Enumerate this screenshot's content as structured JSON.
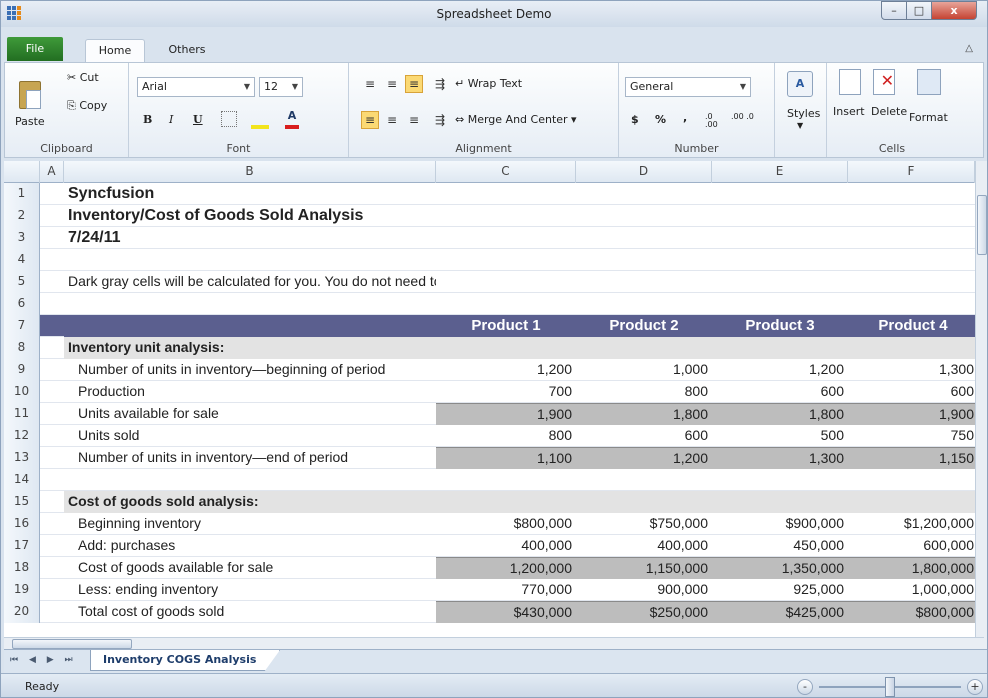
{
  "window": {
    "title": "Spreadsheet Demo",
    "min_label": "–",
    "max_label": "□",
    "close_label": "x"
  },
  "tabs": {
    "file": "File",
    "home": "Home",
    "others": "Others",
    "collapse": "△"
  },
  "ribbon": {
    "clipboard": {
      "paste": "Paste",
      "cut": "Cut",
      "copy": "Copy",
      "label": "Clipboard"
    },
    "font": {
      "name": "Arial",
      "size": "12",
      "bold": "B",
      "italic": "I",
      "underline": "U",
      "label": "Font"
    },
    "alignment": {
      "wrap_text": "Wrap Text",
      "merge_center": "Merge And Center",
      "label": "Alignment"
    },
    "number": {
      "format": "General",
      "currency": "$",
      "percent": "%",
      "comma": ",",
      "inc_decimal": ".0 .00",
      "dec_decimal": ".00 .0",
      "label": "Number"
    },
    "styles": {
      "label": "Styles"
    },
    "cells": {
      "insert": "Insert",
      "delete": "Delete",
      "format": "Format",
      "label": "Cells"
    }
  },
  "columns": [
    "A",
    "B",
    "C",
    "D",
    "E",
    "F"
  ],
  "rows": [
    {
      "n": "1",
      "b": "Syncfusion",
      "style": "title"
    },
    {
      "n": "2",
      "b": "Inventory/Cost of Goods Sold Analysis",
      "style": "title"
    },
    {
      "n": "3",
      "b": "7/24/11",
      "style": "title"
    },
    {
      "n": "4",
      "b": "",
      "style": "plain"
    },
    {
      "n": "5",
      "b": "Dark gray cells will be calculated for you. You do not need to enter anything into them.",
      "style": "plain"
    },
    {
      "n": "6",
      "b": "",
      "style": "plain"
    },
    {
      "n": "7",
      "b": "",
      "c": "Product 1",
      "d": "Product 2",
      "e": "Product 3",
      "f": "Product 4",
      "style": "header"
    },
    {
      "n": "8",
      "b": "Inventory unit analysis:",
      "style": "section"
    },
    {
      "n": "9",
      "b": "Number of units in inventory—beginning of period",
      "c": "1,200",
      "d": "1,000",
      "e": "1,200",
      "f": "1,300",
      "style": "data"
    },
    {
      "n": "10",
      "b": "Production",
      "c": "700",
      "d": "800",
      "e": "600",
      "f": "600",
      "style": "data"
    },
    {
      "n": "11",
      "b": "Units available for sale",
      "c": "1,900",
      "d": "1,800",
      "e": "1,800",
      "f": "1,900",
      "style": "calc"
    },
    {
      "n": "12",
      "b": "Units sold",
      "c": "800",
      "d": "600",
      "e": "500",
      "f": "750",
      "style": "data"
    },
    {
      "n": "13",
      "b": "Number of units in inventory—end of period",
      "c": "1,100",
      "d": "1,200",
      "e": "1,300",
      "f": "1,150",
      "style": "calc"
    },
    {
      "n": "14",
      "b": "",
      "style": "plain"
    },
    {
      "n": "15",
      "b": "Cost of goods sold analysis:",
      "style": "section"
    },
    {
      "n": "16",
      "b": "Beginning inventory",
      "c": "$800,000",
      "d": "$750,000",
      "e": "$900,000",
      "f": "$1,200,000",
      "style": "data"
    },
    {
      "n": "17",
      "b": "Add: purchases",
      "c": "400,000",
      "d": "400,000",
      "e": "450,000",
      "f": "600,000",
      "style": "data"
    },
    {
      "n": "18",
      "b": "Cost of goods available for sale",
      "c": "1,200,000",
      "d": "1,150,000",
      "e": "1,350,000",
      "f": "1,800,000",
      "style": "calc"
    },
    {
      "n": "19",
      "b": "Less: ending inventory",
      "c": "770,000",
      "d": "900,000",
      "e": "925,000",
      "f": "1,000,000",
      "style": "data"
    },
    {
      "n": "20",
      "b": "Total cost of goods sold",
      "c": "$430,000",
      "d": "$250,000",
      "e": "$425,000",
      "f": "$800,000",
      "style": "calc"
    }
  ],
  "sheet": {
    "tab": "Inventory COGS Analysis",
    "nav": "⏮ ◀ ▶ ⏭"
  },
  "status": {
    "text": "Ready",
    "zoom_minus": "-",
    "zoom_plus": "+",
    "zoom_level": 0.5
  },
  "colors": {
    "header": "#5b5f8f",
    "calc": "#bdbdbd",
    "section": "#e3e3e3",
    "file_tab": "#2d8a2b"
  }
}
